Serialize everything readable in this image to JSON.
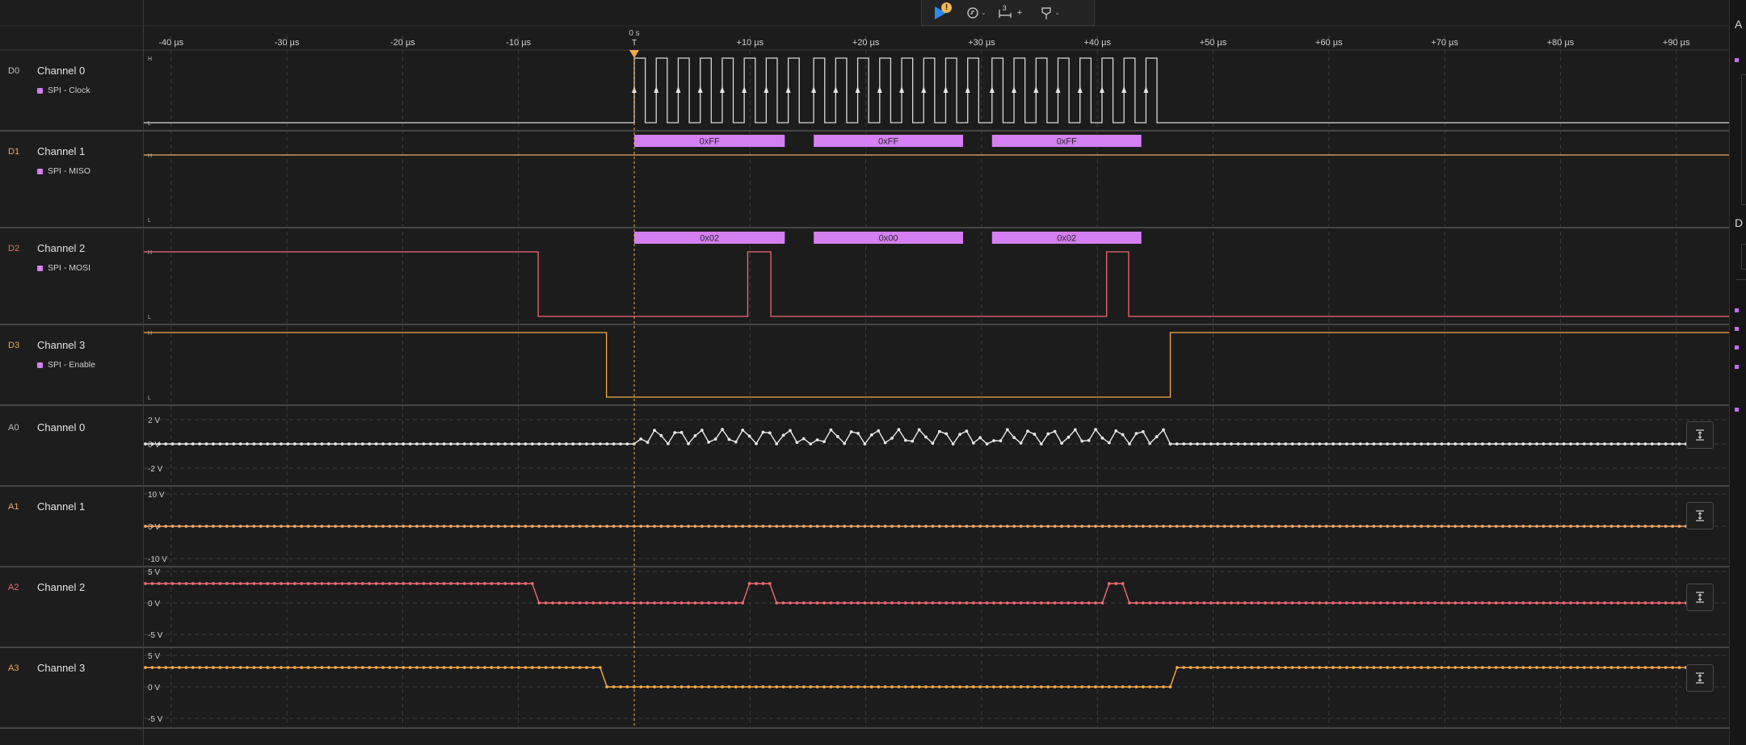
{
  "toolbar": {
    "badge_glyph": "!",
    "sample_count": "3",
    "add_glyph": "+"
  },
  "timeline": {
    "zero_label": "0 s",
    "trigger_label": "T",
    "ticks": [
      {
        "t": -40,
        "label": "-40 µs"
      },
      {
        "t": -30,
        "label": "-30 µs"
      },
      {
        "t": -20,
        "label": "-20 µs"
      },
      {
        "t": -10,
        "label": "-10 µs"
      },
      {
        "t": 10,
        "label": "+10 µs"
      },
      {
        "t": 20,
        "label": "+20 µs"
      },
      {
        "t": 30,
        "label": "+30 µs"
      },
      {
        "t": 40,
        "label": "+40 µs"
      },
      {
        "t": 50,
        "label": "+50 µs"
      },
      {
        "t": 60,
        "label": "+60 µs"
      },
      {
        "t": 70,
        "label": "+70 µs"
      },
      {
        "t": 80,
        "label": "+80 µs"
      },
      {
        "t": 90,
        "label": "+90 µs"
      }
    ]
  },
  "level_labels": {
    "high": "H",
    "low": "L"
  },
  "channels": {
    "d0": {
      "id": "D0",
      "name": "Channel 0",
      "analyzer": "SPI - Clock",
      "color": "#d9d9d9"
    },
    "d1": {
      "id": "D1",
      "name": "Channel 1",
      "analyzer": "SPI - MISO",
      "color": "#f0a868"
    },
    "d2": {
      "id": "D2",
      "name": "Channel 2",
      "analyzer": "SPI - MOSI",
      "color": "#ee6a72"
    },
    "d3": {
      "id": "D3",
      "name": "Channel 3",
      "analyzer": "SPI - Enable",
      "color": "#f3a84a"
    },
    "a0": {
      "id": "A0",
      "name": "Channel 0",
      "color": "#e6e6e6",
      "scale": [
        "2 V",
        "0 V",
        "-2 V"
      ]
    },
    "a1": {
      "id": "A1",
      "name": "Channel 1",
      "color": "#f0a868",
      "scale": [
        "10 V",
        "0 V",
        "-10 V"
      ]
    },
    "a2": {
      "id": "A2",
      "name": "Channel 2",
      "color": "#ee6a72",
      "scale": [
        "5 V",
        "0 V",
        "-5 V"
      ]
    },
    "a3": {
      "id": "A3",
      "name": "Channel 3",
      "color": "#f3a84a",
      "scale": [
        "5 V",
        "0 V",
        "-5 V"
      ]
    }
  },
  "decoded": {
    "color": "#d47ff2",
    "miso": [
      {
        "start": 0,
        "end": 13,
        "label": "0xFF"
      },
      {
        "start": 15.5,
        "end": 28.4,
        "label": "0xFF"
      },
      {
        "start": 30.9,
        "end": 43.8,
        "label": "0xFF"
      }
    ],
    "mosi": [
      {
        "start": 0,
        "end": 13,
        "label": "0x02"
      },
      {
        "start": 15.5,
        "end": 28.4,
        "label": "0x00"
      },
      {
        "start": 30.9,
        "end": 43.8,
        "label": "0x02"
      }
    ]
  },
  "right_panel": {
    "top_letter": "A",
    "mid_letter": "D"
  }
}
